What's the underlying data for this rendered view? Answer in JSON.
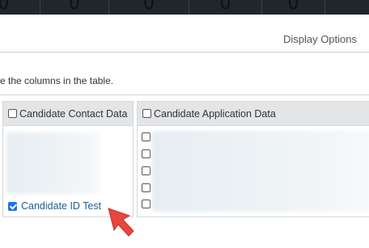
{
  "stats_bar": {
    "values": [
      "0",
      "0",
      "0",
      "0",
      "0"
    ]
  },
  "header": {
    "display_options_label": "Display Options"
  },
  "instructions": {
    "text": "e the columns in the table."
  },
  "columns": {
    "contact": {
      "header_label": "Candidate Contact Data",
      "items": [
        {
          "label": "Candidate ID Test",
          "checked": true
        }
      ]
    },
    "application": {
      "header_label": "Candidate Application Data",
      "item_count": 5
    }
  },
  "colors": {
    "top_bar": "#1f262c",
    "link": "#1b5f9a",
    "check": "#1a73e8",
    "arrow": "#e8453c"
  }
}
